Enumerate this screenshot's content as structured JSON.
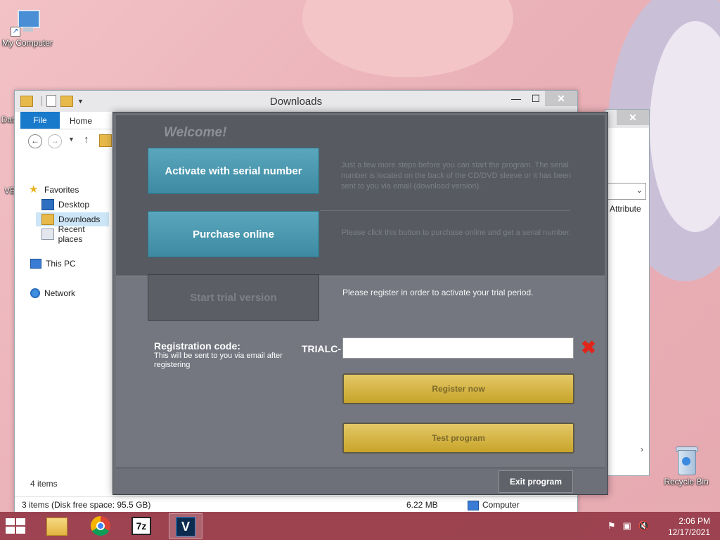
{
  "desktop": {
    "icons": [
      {
        "label": "My Computer"
      },
      {
        "label": "Recycle Bin"
      }
    ],
    "partial_labels": [
      "Dat",
      "VE"
    ]
  },
  "explorer": {
    "title": "Downloads",
    "ribbon_tabs": [
      "File",
      "Home"
    ],
    "window_buttons": {
      "minimize": "—",
      "maximize": "☐",
      "close": "✕"
    },
    "sidebar": [
      {
        "label": "Favorites",
        "icon": "star-icon"
      },
      {
        "label": "Desktop",
        "icon": "desktop-folder-icon"
      },
      {
        "label": "Downloads",
        "icon": "downloads-folder-icon",
        "selected": true
      },
      {
        "label": "Recent places",
        "icon": "recent-places-icon"
      },
      {
        "label": "This PC",
        "icon": "computer-icon"
      },
      {
        "label": "Network",
        "icon": "network-icon"
      }
    ],
    "items_count": "4 items",
    "status": {
      "left": "3 items (Disk free space: 95.5 GB)",
      "size": "6.22 MB",
      "location": "Computer"
    }
  },
  "explorer2": {
    "close": "✕",
    "column_header": "Attribute"
  },
  "dialog": {
    "welcome": "Welcome!",
    "activate_button": "Activate with serial number",
    "activate_desc": "Just a few more steps before you can start the program. The serial number is located on the back of the CD/DVD sleeve or it has been sent to you via email (download version).",
    "purchase_button": "Purchase online",
    "purchase_desc": "Please click this button to purchase online and get a serial number.",
    "trial_button": "Start trial version",
    "trial_desc": "Please register in order to activate your trial period.",
    "registration_label": "Registration code:",
    "registration_sub": "This will be sent to you via email after registering",
    "code_prefix": "TRIALC-",
    "code_value": "",
    "register_button": "Register now",
    "test_button": "Test program",
    "exit_button": "Exit program",
    "colors": {
      "teal": "#4a98b0",
      "gold": "#d4b548",
      "clear_red": "#e0251b"
    }
  },
  "taskbar": {
    "apps": [
      "file-explorer-icon",
      "chrome-icon",
      "7zip-icon",
      "vegas-icon"
    ],
    "app_glyphs": {
      "sevenzip": "7z",
      "vegas": "V"
    },
    "tray_icons": [
      "action-center-flag-icon",
      "network-tray-icon",
      "volume-muted-icon"
    ],
    "time": "2:06 PM",
    "date": "12/17/2021"
  }
}
